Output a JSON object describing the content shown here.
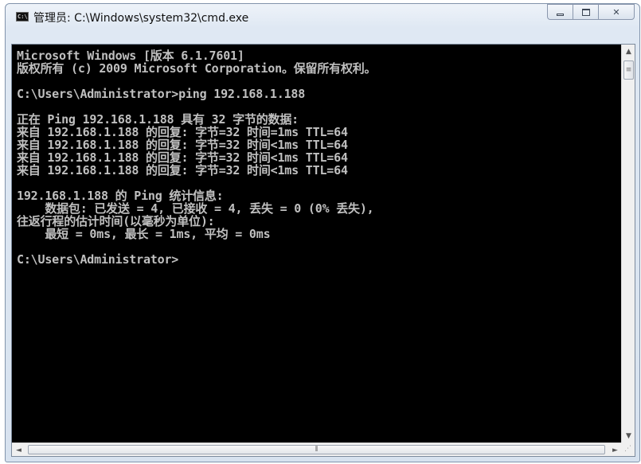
{
  "window": {
    "title": "管理员: C:\\Windows\\system32\\cmd.exe",
    "icon": "cmd-app-icon",
    "icon_text": "C:\\",
    "controls": {
      "minimize": "minimize-icon",
      "maximize": "maximize-icon",
      "close_label": "✕"
    }
  },
  "console": {
    "colors": {
      "background": "#000000",
      "text": "#c0c0c0"
    },
    "lines": [
      "Microsoft Windows [版本 6.1.7601]",
      "版权所有 (c) 2009 Microsoft Corporation。保留所有权利。",
      "",
      "C:\\Users\\Administrator>ping 192.168.1.188",
      "",
      "正在 Ping 192.168.1.188 具有 32 字节的数据:",
      "来自 192.168.1.188 的回复: 字节=32 时间=1ms TTL=64",
      "来自 192.168.1.188 的回复: 字节=32 时间<1ms TTL=64",
      "来自 192.168.1.188 的回复: 字节=32 时间<1ms TTL=64",
      "来自 192.168.1.188 的回复: 字节=32 时间<1ms TTL=64",
      "",
      "192.168.1.188 的 Ping 统计信息:",
      "    数据包: 已发送 = 4, 已接收 = 4, 丢失 = 0 (0% 丢失),",
      "往返行程的估计时间(以毫秒为单位):",
      "    最短 = 0ms, 最长 = 1ms, 平均 = 0ms",
      "",
      "C:\\Users\\Administrator>"
    ]
  },
  "scrollbars": {
    "up_arrow": "▲",
    "down_arrow": "▼",
    "left_arrow": "◄",
    "right_arrow": "►",
    "vthumb_grip": "≡",
    "hthumb_grip": "⫴",
    "resize_grip": "⋰"
  }
}
